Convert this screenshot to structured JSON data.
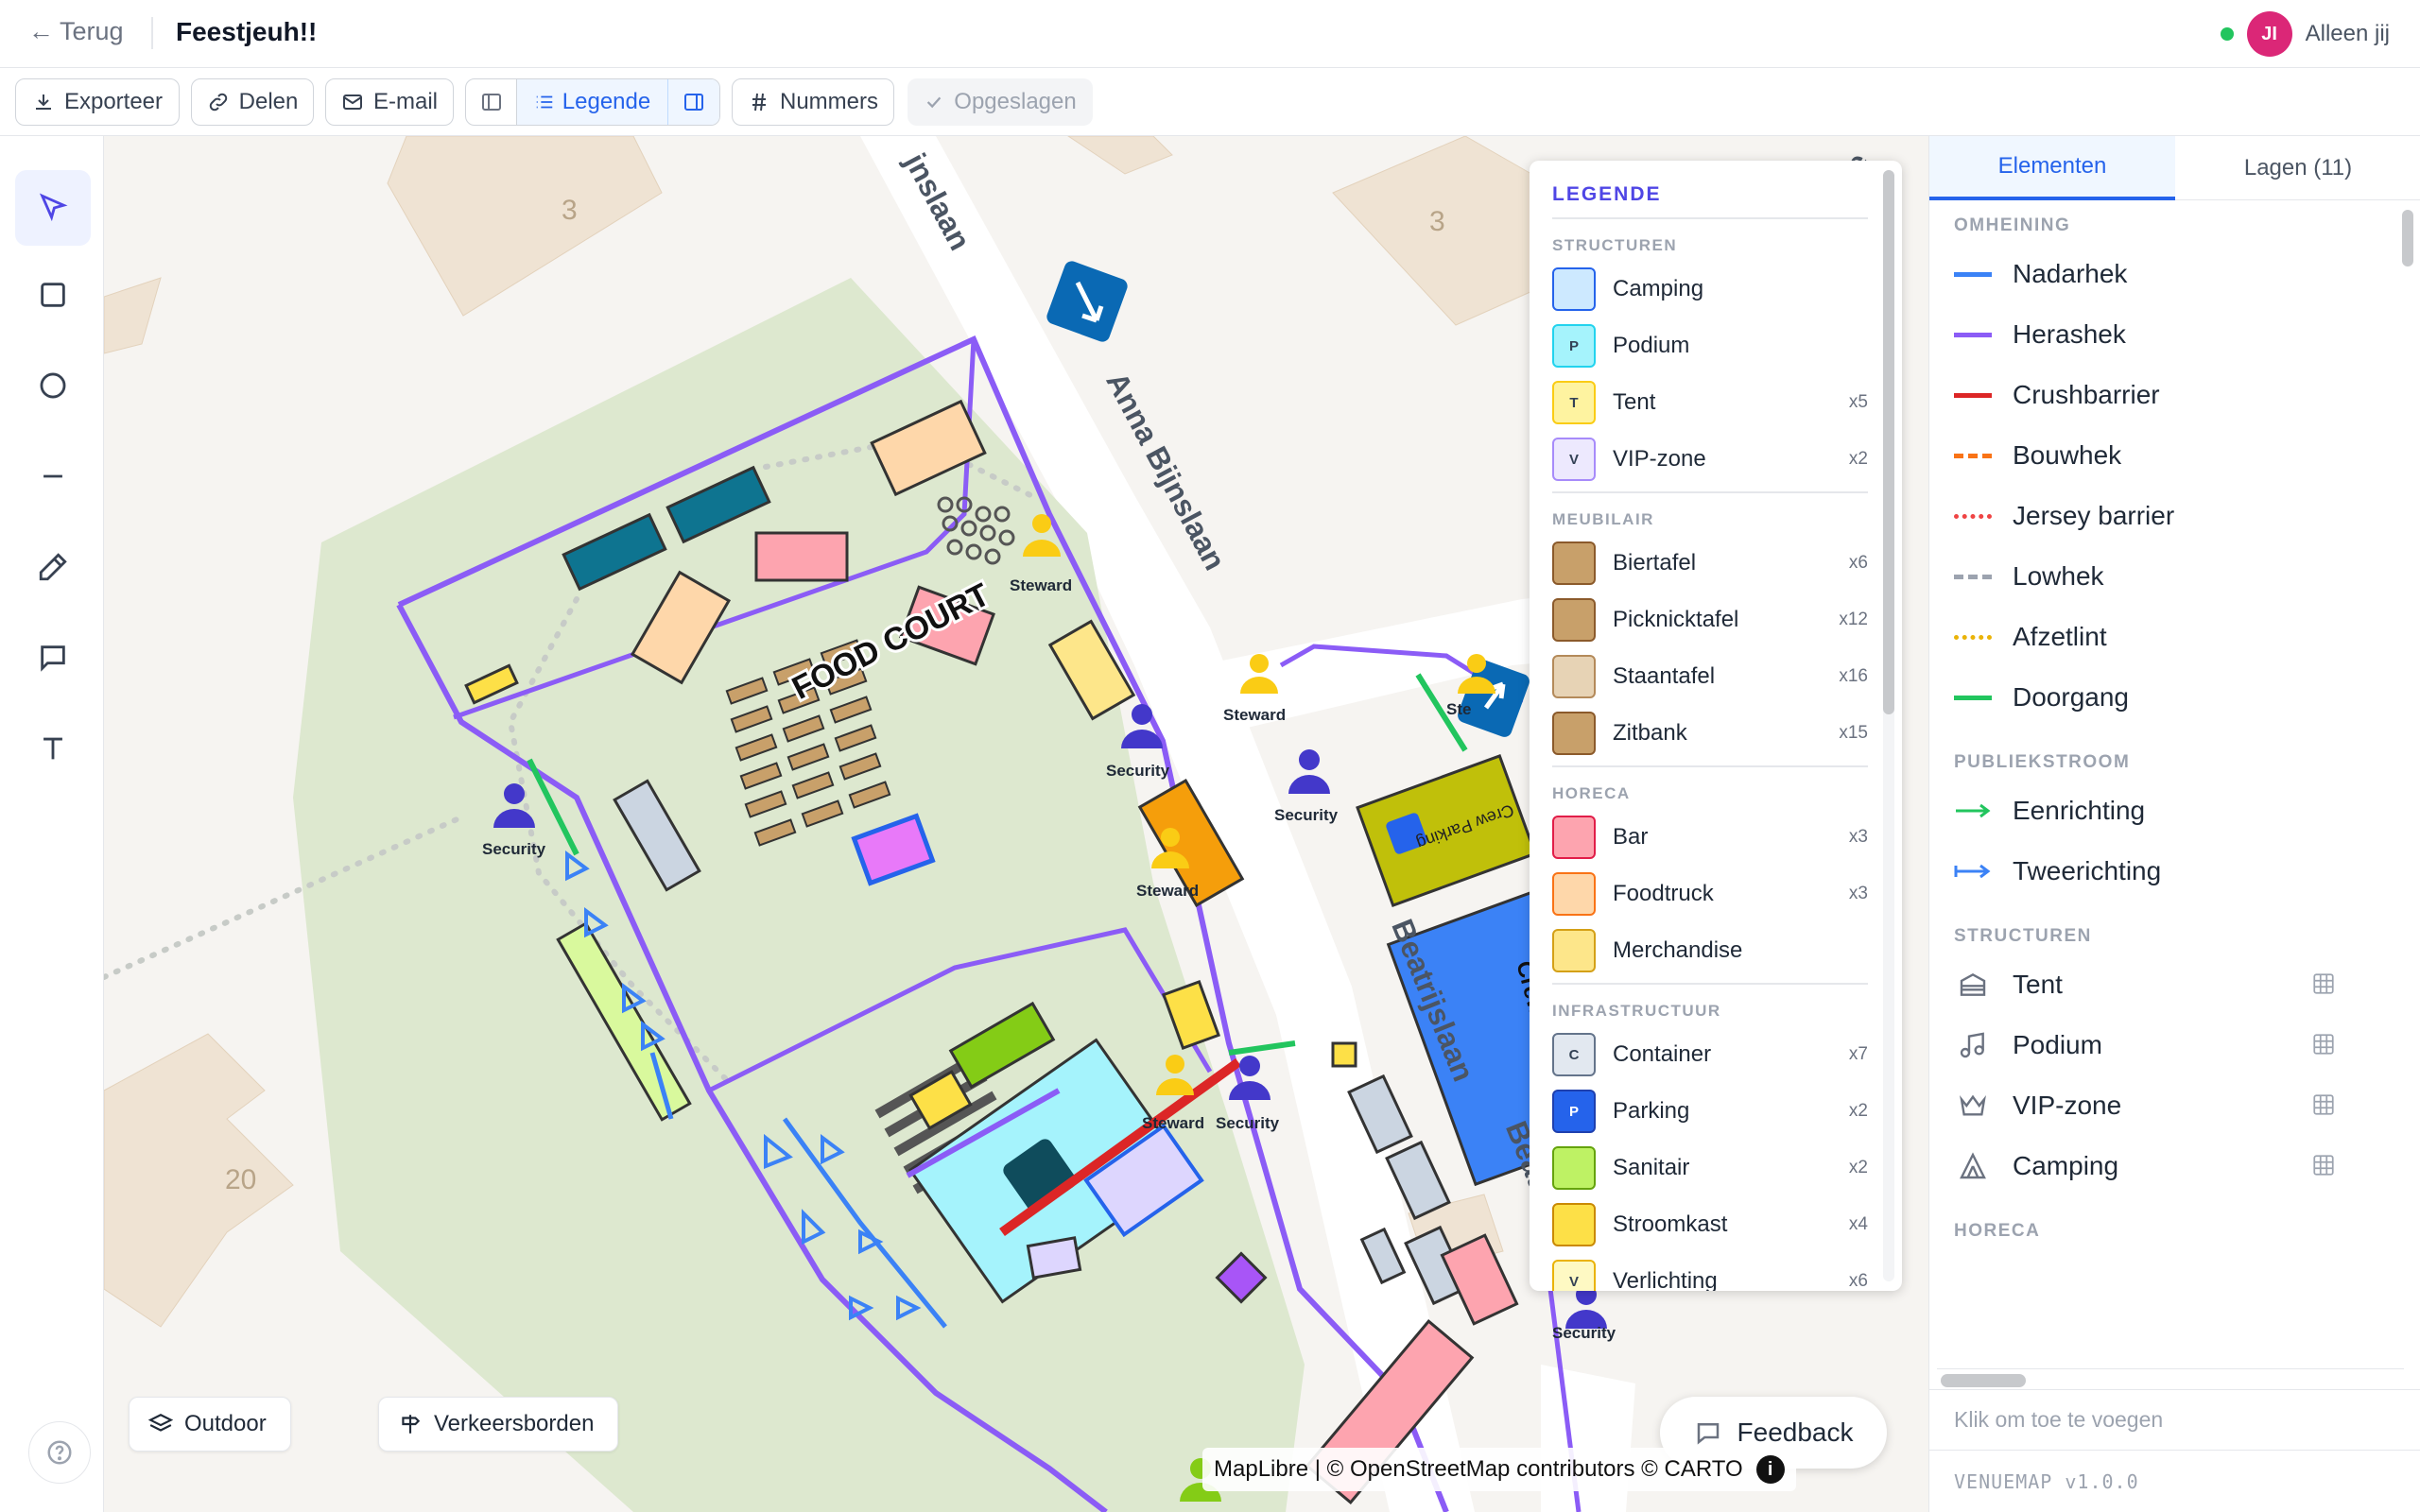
{
  "header": {
    "back_label": "Terug",
    "title": "Feestjeuh!!",
    "avatar_initials": "JI",
    "presence_label": "Alleen jij"
  },
  "toolbar": {
    "export": "Exporteer",
    "share": "Delen",
    "email": "E-mail",
    "legend": "Legende",
    "numbers": "Nummers",
    "saved": "Opgeslagen"
  },
  "map": {
    "streets": [
      "Anna Bijnslaan",
      "Beatrijslaan",
      "Beatrijslaan",
      "jnslaan",
      "Be"
    ],
    "house_numbers": [
      "3",
      "3",
      "20"
    ],
    "food_court": "FOOD COURT",
    "roles": [
      "Steward",
      "Steward",
      "Security",
      "Security",
      "Steward",
      "Security",
      "Security",
      "Steward",
      "Security",
      "Security",
      "Ste"
    ],
    "parking_labels": [
      "Crew Parking",
      "Crew Catering"
    ],
    "outdoor_button": "Outdoor",
    "traffic_button": "Verkeersborden",
    "feedback": "Feedback",
    "attribution": "MapLibre | © OpenStreetMap contributors © CARTO"
  },
  "legend": {
    "title": "LEGENDE",
    "groups": [
      {
        "title": "STRUCTUREN",
        "items": [
          {
            "label": "Camping",
            "count": "",
            "glyph": "",
            "bg": "#cde9ff",
            "border": "#2563eb"
          },
          {
            "label": "Podium",
            "count": "",
            "glyph": "P",
            "bg": "#a5f3fc",
            "border": "#22d3ee"
          },
          {
            "label": "Tent",
            "count": "x5",
            "glyph": "T",
            "bg": "#fef3a0",
            "border": "#facc15"
          },
          {
            "label": "VIP-zone",
            "count": "x2",
            "glyph": "V",
            "bg": "#ede9fe",
            "border": "#a78bfa"
          }
        ]
      },
      {
        "title": "MEUBILAIR",
        "items": [
          {
            "label": "Biertafel",
            "count": "x6",
            "glyph": "",
            "bg": "#c8a06a",
            "border": "#8b5a2b"
          },
          {
            "label": "Picknicktafel",
            "count": "x12",
            "glyph": "",
            "bg": "#c8a06a",
            "border": "#8b5a2b"
          },
          {
            "label": "Staantafel",
            "count": "x16",
            "glyph": "",
            "bg": "#e7d3b5",
            "border": "#b48a5a"
          },
          {
            "label": "Zitbank",
            "count": "x15",
            "glyph": "",
            "bg": "#c8a06a",
            "border": "#8b5a2b"
          }
        ]
      },
      {
        "title": "HORECA",
        "items": [
          {
            "label": "Bar",
            "count": "x3",
            "glyph": "",
            "bg": "#fda4af",
            "border": "#e11d48"
          },
          {
            "label": "Foodtruck",
            "count": "x3",
            "glyph": "",
            "bg": "#fed7aa",
            "border": "#f97316"
          },
          {
            "label": "Merchandise",
            "count": "",
            "glyph": "",
            "bg": "#fde68a",
            "border": "#d4a017"
          }
        ]
      },
      {
        "title": "INFRASTRUCTUUR",
        "items": [
          {
            "label": "Container",
            "count": "x7",
            "glyph": "C",
            "bg": "#e2e8f0",
            "border": "#64748b"
          },
          {
            "label": "Parking",
            "count": "x2",
            "glyph": "P",
            "bg": "#2563eb",
            "border": "#1e40af"
          },
          {
            "label": "Sanitair",
            "count": "x2",
            "glyph": "",
            "bg": "#bef264",
            "border": "#65a30d"
          },
          {
            "label": "Stroomkast",
            "count": "x4",
            "glyph": "",
            "bg": "#fde047",
            "border": "#ca8a04"
          },
          {
            "label": "Verlichting",
            "count": "x6",
            "glyph": "V",
            "bg": "#fef9c3",
            "border": "#eab308"
          }
        ]
      }
    ]
  },
  "panel": {
    "tabs": [
      "Elementen",
      "Lagen (11)"
    ],
    "sections": [
      {
        "title": "OMHEINING",
        "items": [
          {
            "label": "Nadarhek",
            "color": "#3b82f6",
            "style": "solid"
          },
          {
            "label": "Herashek",
            "color": "#8b5cf6",
            "style": "solid"
          },
          {
            "label": "Crushbarrier",
            "color": "#dc2626",
            "style": "solid"
          },
          {
            "label": "Bouwhek",
            "color": "#f97316",
            "style": "dashed"
          },
          {
            "label": "Jersey barrier",
            "color": "#ef4444",
            "style": "dotted"
          },
          {
            "label": "Lowhek",
            "color": "#9ca3af",
            "style": "dashed"
          },
          {
            "label": "Afzetlint",
            "color": "#eab308",
            "style": "dotted"
          },
          {
            "label": "Doorgang",
            "color": "#22c55e",
            "style": "solid"
          }
        ]
      },
      {
        "title": "PUBLIEKSTROOM",
        "items": [
          {
            "label": "Eenrichting",
            "color": "#22c55e",
            "style": "arrow"
          },
          {
            "label": "Tweerichting",
            "color": "#3b82f6",
            "style": "arrow2"
          }
        ]
      },
      {
        "title": "STRUCTUREN",
        "items": [
          {
            "label": "Tent",
            "icon": "tent-icon"
          },
          {
            "label": "Podium",
            "icon": "music-icon"
          },
          {
            "label": "VIP-zone",
            "icon": "crown-icon"
          },
          {
            "label": "Camping",
            "icon": "camping-icon"
          }
        ]
      },
      {
        "title": "HORECA",
        "items": []
      }
    ],
    "add_placeholder": "Klik om toe te voegen",
    "version": "VENUEMAP v1.0.0"
  }
}
